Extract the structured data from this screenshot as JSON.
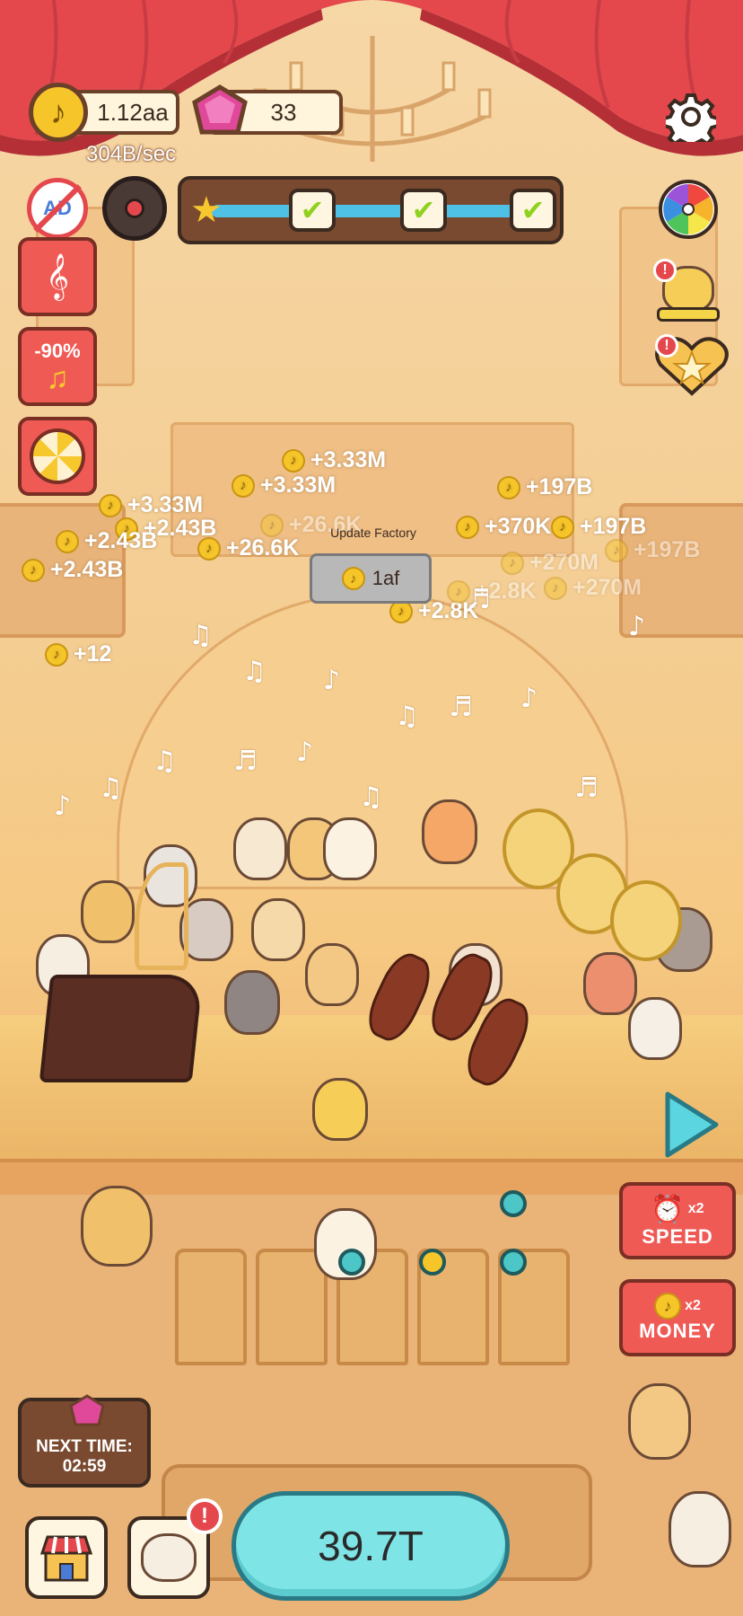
{
  "hud": {
    "coins_value": "1.12aa",
    "coins_rate": "304B/sec",
    "gems_value": "33",
    "progress_checks": 3
  },
  "factory": {
    "title": "Update Factory",
    "cost": "1af"
  },
  "floating_rewards": [
    "+3.33M",
    "+3.33M",
    "+3.33M",
    "+2.43B",
    "+2.43B",
    "+2.43B",
    "+26.6K",
    "+26.6K",
    "+370K",
    "+197B",
    "+197B",
    "+197B",
    "+270M",
    "+270M",
    "+2.8K",
    "+2.8K",
    "+12"
  ],
  "side_buttons": {
    "discount": "-90%",
    "speed_multiplier": "x2",
    "speed_label": "SPEED",
    "money_multiplier": "x2",
    "money_label": "MONEY"
  },
  "gem_timer": {
    "label": "NEXT TIME:",
    "time": "02:59"
  },
  "main_button": {
    "value": "39.7T"
  },
  "colors": {
    "curtain": "#e4484d",
    "main_button": "#7fe4e6",
    "red_button": "#ef5a55",
    "coin": "#f5c52a",
    "gem": "#e0489a"
  }
}
